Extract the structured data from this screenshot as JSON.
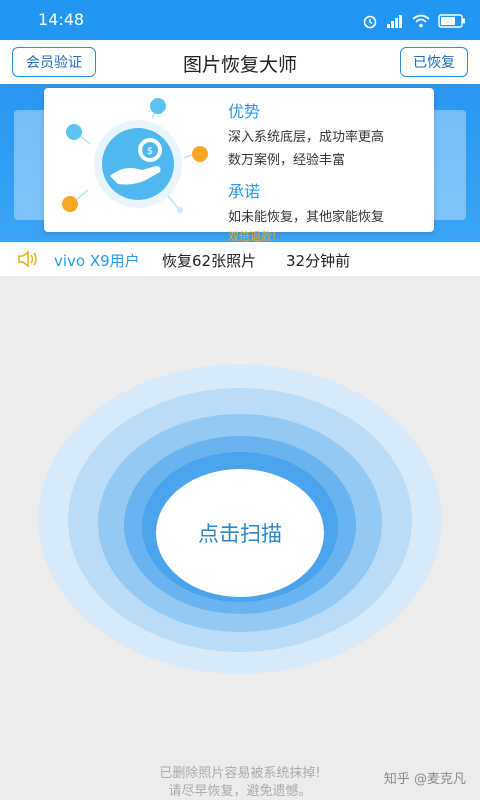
{
  "status_bar": {
    "time": "14:48",
    "icons": [
      "alarm-icon",
      "signal-icon",
      "wifi-icon",
      "battery-icon"
    ],
    "background": "#2196f3"
  },
  "header": {
    "left_button": "会员验证",
    "title": "图片恢复大师",
    "right_button": "已恢复"
  },
  "banner": {
    "advantage_title": "优势",
    "advantage_line1": "深入系统底层，成功率更高",
    "advantage_line2": "数万案例，经验丰富",
    "promise_title": "承诺",
    "promise_line1": "如未能恢复，其他家能恢复",
    "promise_highlight": "双倍退款!"
  },
  "notice": {
    "user": "vivo X9用户",
    "action": "恢复62张照片",
    "time": "32分钟前"
  },
  "scan": {
    "button_label": "点击扫描"
  },
  "footer": {
    "line1": "已删除照片容易被系统抹掉!",
    "line2": "请尽早恢复，避免遗憾。"
  },
  "watermark": "知乎 @麦克凡",
  "colors": {
    "accent": "#2a9ae5",
    "highlight": "#f5a623"
  }
}
